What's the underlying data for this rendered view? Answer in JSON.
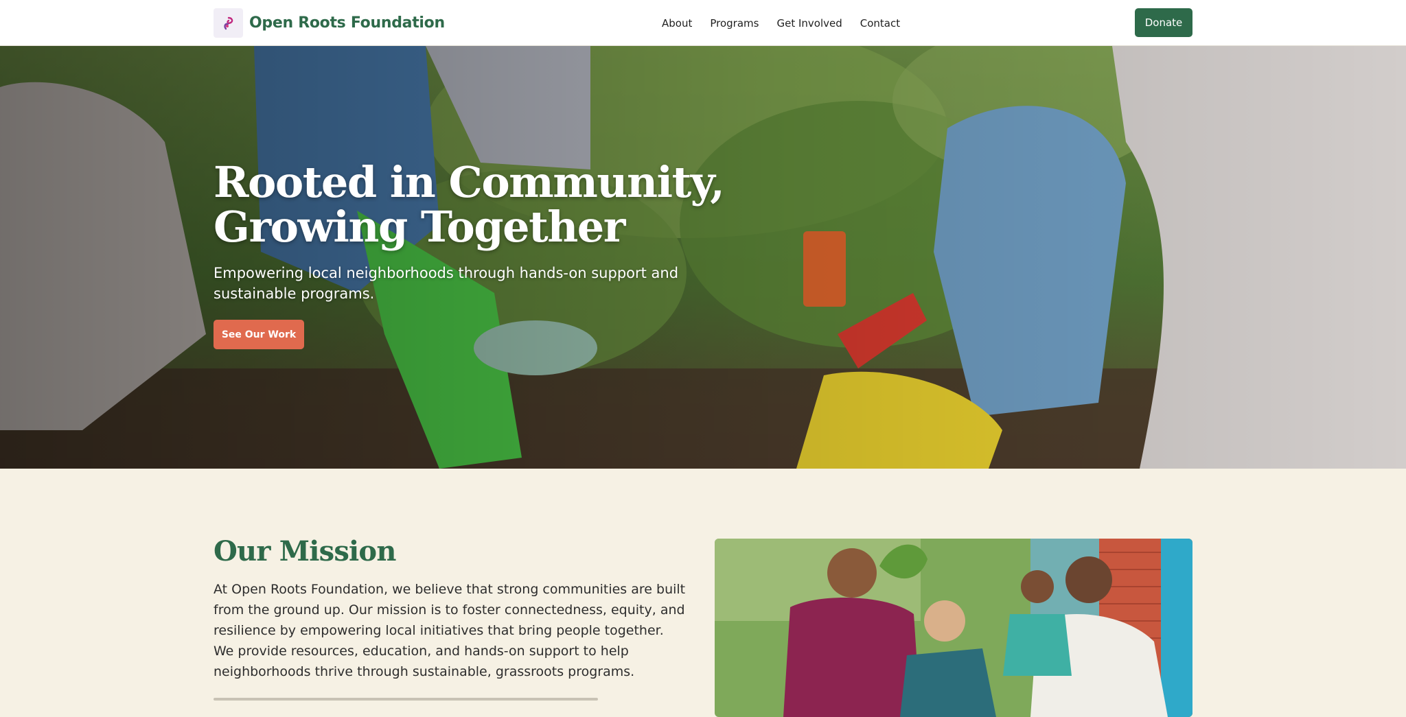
{
  "header": {
    "brand": "Open Roots Foundation",
    "logo_icon": "swirl-leaf-icon",
    "nav": [
      "About",
      "Programs",
      "Get Involved",
      "Contact"
    ],
    "donate_label": "Donate"
  },
  "hero": {
    "title_line1": "Rooted in Community,",
    "title_line2": "Growing Together",
    "subtitle": "Empowering local neighborhoods through hands-on support and sustainable programs.",
    "cta_label": "See Our Work"
  },
  "mission": {
    "title": "Our Mission",
    "body": "At Open Roots Foundation, we believe that strong communities are built from the ground up. Our mission is to foster connectedness, equity, and resilience by empowering local initiatives that bring people together. We provide resources, education, and hands-on support to help neighborhoods thrive through sustainable, grassroots programs."
  },
  "colors": {
    "brand_green": "#2e6a4a",
    "accent_coral": "#e06a4e",
    "cream_bg": "#f6f1e4"
  }
}
